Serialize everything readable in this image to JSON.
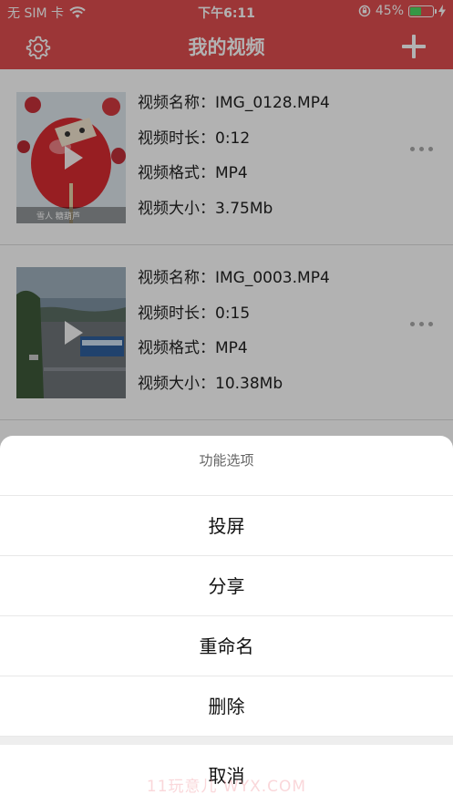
{
  "status_bar": {
    "carrier": "无 SIM 卡",
    "time": "下午6:11",
    "battery_percent": "45%",
    "battery_level": 0.45
  },
  "nav": {
    "title": "我的视频",
    "left_icon": "gear-icon",
    "right_icon": "plus-icon"
  },
  "videos": [
    {
      "name": "视频名称：IMG_0128.MP4",
      "duration": "视频时长：0:12",
      "format": "视频格式：MP4",
      "size": "视频大小：3.75Mb",
      "thumb_caption": "雪人 糖葫芦"
    },
    {
      "name": "视频名称：IMG_0003.MP4",
      "duration": "视频时长：0:15",
      "format": "视频格式：MP4",
      "size": "视频大小：10.38Mb"
    }
  ],
  "action_sheet": {
    "title": "功能选项",
    "options": [
      "投屏",
      "分享",
      "重命名",
      "删除"
    ],
    "cancel": "取消"
  },
  "watermark": "11玩意儿 WYX.COM",
  "colors": {
    "accent": "#e04e4f",
    "battery_fill": "#4cd964"
  }
}
